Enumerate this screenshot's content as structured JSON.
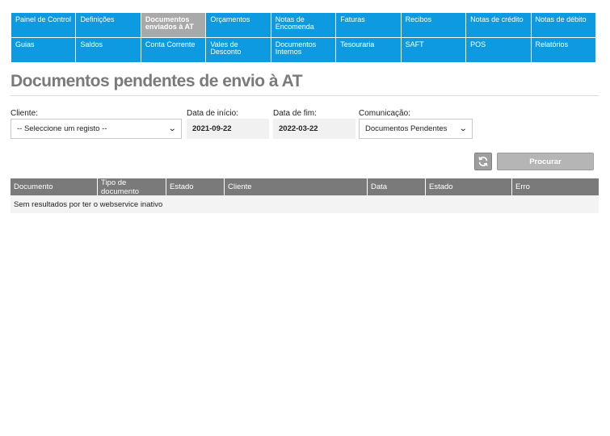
{
  "nav": {
    "items": [
      {
        "label": "Painel de Control"
      },
      {
        "label": "Definições"
      },
      {
        "label": "Documentos enviados à AT"
      },
      {
        "label": "Orçamentos"
      },
      {
        "label": "Notas de Encomenda"
      },
      {
        "label": "Faturas"
      },
      {
        "label": "Recibos"
      },
      {
        "label": "Notas de crédito"
      },
      {
        "label": "Notas de débito"
      },
      {
        "label": "Guias"
      },
      {
        "label": "Saldos"
      },
      {
        "label": "Conta Corrente"
      },
      {
        "label": "Vales de Desconto"
      },
      {
        "label": "Documentos Internos"
      },
      {
        "label": "Tesouraria"
      },
      {
        "label": "SAFT"
      },
      {
        "label": "POS"
      },
      {
        "label": "Relatórios"
      }
    ],
    "active_label": "Documentos enviados à AT"
  },
  "page": {
    "title": "Documentos pendentes de envio à AT"
  },
  "filters": {
    "client_label": "Cliente:",
    "client_value": "-- Seleccione um registo --",
    "start_label": "Data de início:",
    "start_value": "2021-09-22",
    "end_label": "Data de fim:",
    "end_value": "2022-03-22",
    "comm_label": "Comunicação:",
    "comm_value": "Documentos Pendentes"
  },
  "actions": {
    "refresh_icon": "refresh-icon",
    "search_label": "Procurar"
  },
  "table": {
    "columns": [
      "Documento",
      "Tipo de documento",
      "Estado",
      "Cliente",
      "Data",
      "Estado",
      "Erro"
    ],
    "empty_message": "Sem resultados por ter o webservice inativo"
  },
  "colors": {
    "nav_bg": "#0e9ae0",
    "nav_active_bg": "#a9a9a9",
    "header_bg": "#7a7a7a",
    "title": "#7a7a7a"
  }
}
